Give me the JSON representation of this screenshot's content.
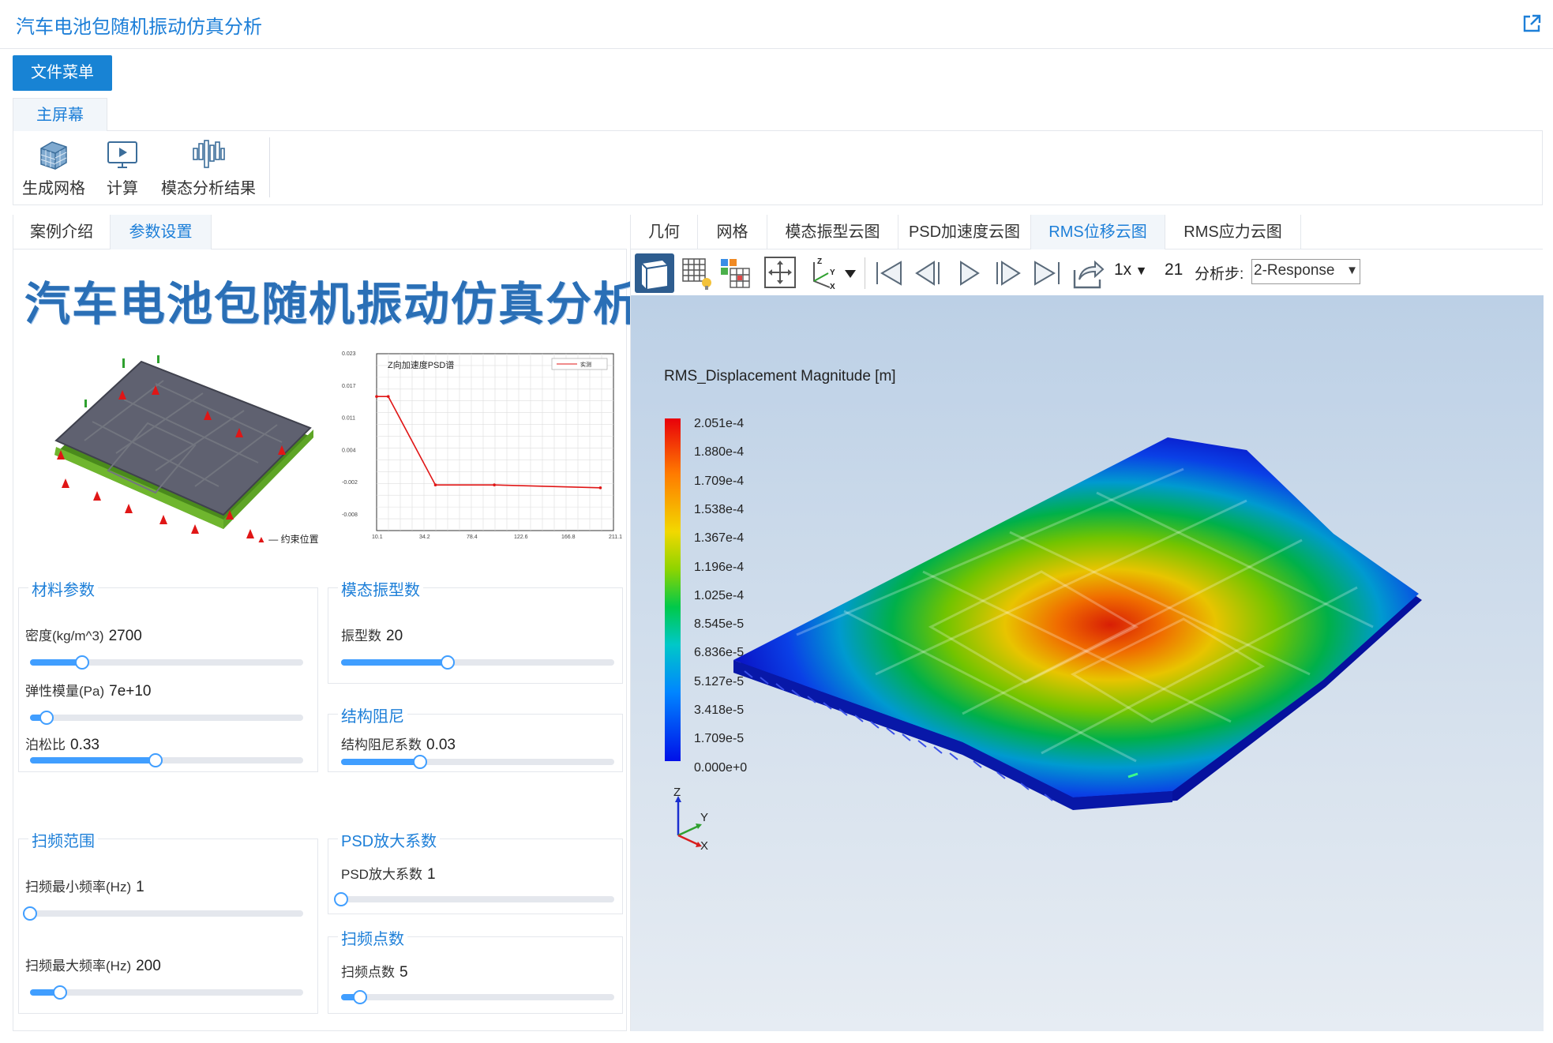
{
  "app": {
    "title": "汽车电池包随机振动仿真分析"
  },
  "file_menu": {
    "label": "文件菜单"
  },
  "ribbon": {
    "tab": "主屏幕",
    "buttons": [
      {
        "label": "生成网格",
        "icon": "mesh-cube-icon"
      },
      {
        "label": "计算",
        "icon": "compute-monitor-icon"
      },
      {
        "label": "模态分析结果",
        "icon": "modal-result-icon"
      }
    ]
  },
  "left_tabs": [
    {
      "label": "案例介绍",
      "active": false
    },
    {
      "label": "参数设置",
      "active": true
    }
  ],
  "hero": {
    "title": "汽车电池包随机振动仿真分析",
    "constraint_legend": "约束位置"
  },
  "psd_chart": {
    "title": "Z向加速度PSD谱",
    "legend": "实测",
    "y_ticks": [
      "0.023",
      "0.017",
      "0.011",
      "0.004",
      "-0.002",
      "-0.008"
    ],
    "x_ticks": [
      "10.1",
      "34.2",
      "78.4",
      "122.6",
      "166.8",
      "211.1"
    ],
    "chart_data": {
      "type": "line",
      "x": [
        10.1,
        20,
        60,
        110,
        200
      ],
      "y": [
        0.0155,
        0.0155,
        0.0,
        0.0,
        -0.0005
      ],
      "ylim": [
        -0.008,
        0.023
      ],
      "xlim": [
        10.1,
        211.1
      ]
    }
  },
  "params": {
    "material": {
      "title": "材料参数",
      "density": {
        "label": "密度(kg/m^3)",
        "value": "2700",
        "slider": 0.19
      },
      "modulus": {
        "label": "弹性模量(Pa)",
        "value": "7e+10",
        "slider": 0.06
      },
      "poisson": {
        "label": "泊松比",
        "value": "0.33",
        "slider": 0.46
      }
    },
    "modes": {
      "title": "模态振型数",
      "count": {
        "label": "振型数",
        "value": "20",
        "slider": 0.39
      }
    },
    "damping": {
      "title": "结构阻尼",
      "coef": {
        "label": "结构阻尼系数",
        "value": "0.03",
        "slider": 0.29
      }
    },
    "sweep": {
      "title": "扫频范围",
      "fmin": {
        "label": "扫频最小频率(Hz)",
        "value": "1",
        "slider": 0.0
      },
      "fmax": {
        "label": "扫频最大频率(Hz)",
        "value": "200",
        "slider": 0.11
      }
    },
    "psd_factor": {
      "title": "PSD放大系数",
      "factor": {
        "label": "PSD放大系数",
        "value": "1",
        "slider": 0.0
      }
    },
    "sweep_points": {
      "title": "扫频点数",
      "points": {
        "label": "扫频点数",
        "value": "5",
        "slider": 0.07
      }
    }
  },
  "right_tabs": [
    {
      "label": "几何",
      "active": false
    },
    {
      "label": "网格",
      "active": false
    },
    {
      "label": "模态振型云图",
      "active": false
    },
    {
      "label": "PSD加速度云图",
      "active": false
    },
    {
      "label": "RMS位移云图",
      "active": true
    },
    {
      "label": "RMS应力云图",
      "active": false
    }
  ],
  "viewer_toolbar": {
    "speed": "1x",
    "frame": "21",
    "step_label": "分析步:",
    "step_value": "2-Response"
  },
  "legend": {
    "title": "RMS_Displacement Magnitude [m]",
    "values": [
      "2.051e-4",
      "1.880e-4",
      "1.709e-4",
      "1.538e-4",
      "1.367e-4",
      "1.196e-4",
      "1.025e-4",
      "8.545e-5",
      "6.836e-5",
      "5.127e-5",
      "3.418e-5",
      "1.709e-5",
      "0.000e+0"
    ]
  },
  "triad": {
    "x": "X",
    "y": "Y",
    "z": "Z"
  },
  "colors": {
    "accent": "#1d7fd8",
    "button": "#1883d4",
    "slider": "#409eff"
  }
}
